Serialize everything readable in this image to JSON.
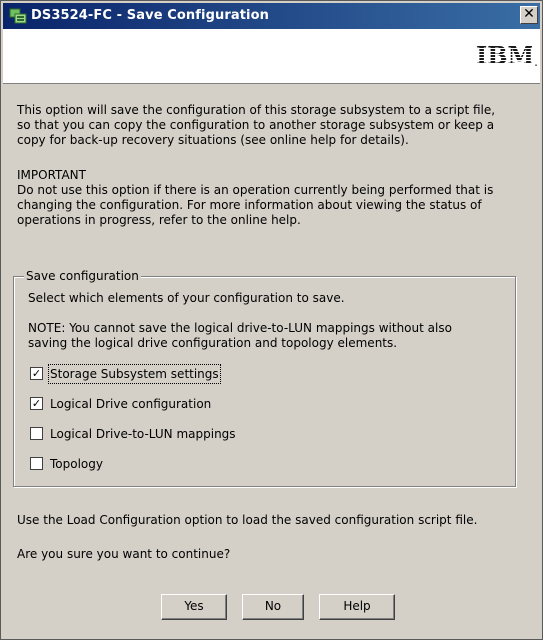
{
  "window": {
    "title": "DS3524-FC - Save Configuration",
    "close_glyph": "✕",
    "brand": "IBM",
    "brand_suffix": "."
  },
  "intro": {
    "line1": "This option will save the configuration of this storage subsystem to a script file,",
    "line2": "so that you can copy the configuration to another storage subsystem or keep a",
    "line3": "copy for back-up recovery situations (see online help for details)."
  },
  "important": {
    "heading": "IMPORTANT",
    "line1": "Do not use this option if there is an operation currently being performed that is",
    "line2": "changing the configuration. For more information about viewing the status of",
    "line3": "operations in progress, refer to the online help."
  },
  "save_config": {
    "legend": "Save configuration",
    "instruction": "Select which elements of your configuration to save.",
    "note_line1": "NOTE: You cannot save the logical drive-to-LUN mappings without also",
    "note_line2": "saving the logical drive configuration and topology elements.",
    "options": [
      {
        "label": "Storage Subsystem settings",
        "checked": true
      },
      {
        "label": "Logical Drive configuration",
        "checked": true
      },
      {
        "label": "Logical Drive-to-LUN mappings",
        "checked": false
      },
      {
        "label": "Topology",
        "checked": false
      }
    ]
  },
  "footer": {
    "load_hint": "Use the Load Configuration option to load the saved configuration script file.",
    "question": "Are you sure you want to continue?"
  },
  "buttons": {
    "yes": "Yes",
    "no": "No",
    "help": "Help"
  }
}
